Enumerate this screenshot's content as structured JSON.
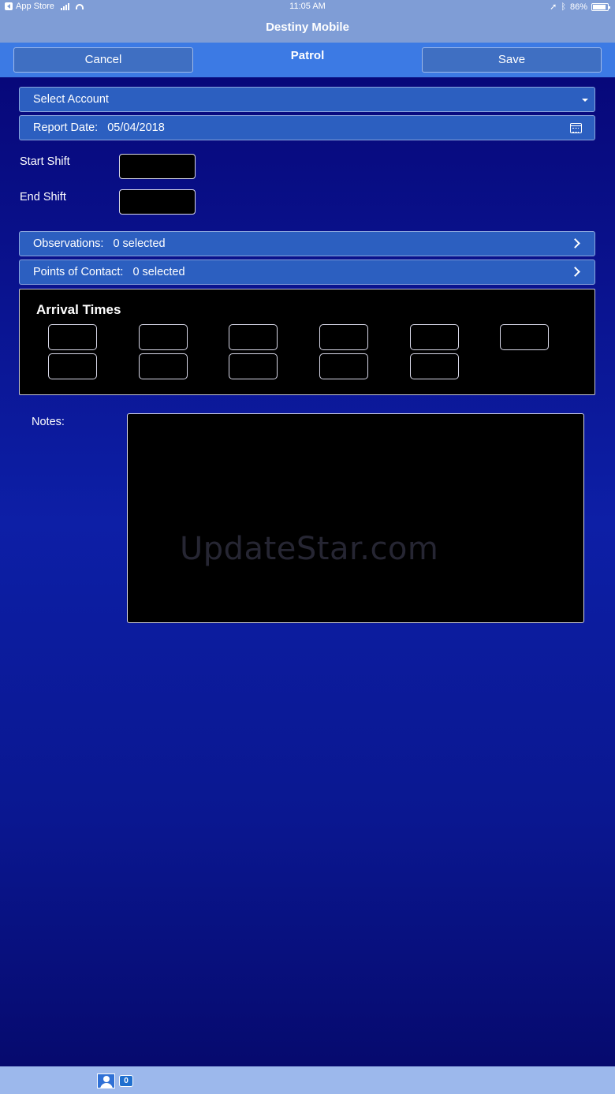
{
  "status_bar": {
    "carrier": "App Store",
    "time": "11:05 AM",
    "battery": "86%"
  },
  "app": {
    "title": "Destiny Mobile"
  },
  "nav": {
    "cancel_label": "Cancel",
    "title": "Patrol",
    "save_label": "Save"
  },
  "form": {
    "account_placeholder": "Select Account",
    "report_date_label": "Report Date:",
    "report_date_value": "05/04/2018",
    "start_shift_label": "Start Shift",
    "start_shift_value": "",
    "end_shift_label": "End Shift",
    "end_shift_value": "",
    "observations_label": "Observations:",
    "observations_value": "0 selected",
    "contacts_label": "Points of Contact:",
    "contacts_value": "0 selected",
    "arrival_title": "Arrival Times",
    "arrival_times": [
      "",
      "",
      "",
      "",
      "",
      "",
      "",
      "",
      "",
      "",
      ""
    ],
    "notes_label": "Notes:",
    "notes_value": ""
  },
  "watermark": "UpdateStar.com",
  "bottom_bar": {
    "count": "0"
  },
  "icons": {
    "back": "back-icon",
    "signal": "signal-icon",
    "wifi": "wifi-icon",
    "location": "location-arrow-icon",
    "bluetooth": "bluetooth-icon",
    "battery": "battery-icon",
    "dropdown": "caret-down-icon",
    "calendar": "calendar-icon",
    "chevron": "chevron-right-icon",
    "user": "user-icon"
  },
  "colors": {
    "header": "#7f9dd6",
    "nav_bar": "#3c7ae4",
    "field": "#2c5fc0",
    "background": "#0a0a7a",
    "bottom_bar": "#9cb8ec"
  }
}
